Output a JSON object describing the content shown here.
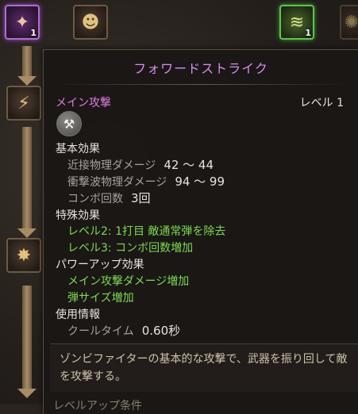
{
  "tree": {
    "top_left_badge": "1",
    "top_right_badge": "1"
  },
  "tooltip": {
    "title": "フォワードストライク",
    "kind": "メイン攻撃",
    "level": "レベル 1",
    "sections": {
      "base": {
        "label": "基本効果",
        "melee_label": "近接物理ダメージ",
        "melee_value": "42 ～ 44",
        "shock_label": "衝撃波物理ダメージ",
        "shock_value": "94 ～ 99",
        "combo_label": "コンボ回数",
        "combo_value": "3回"
      },
      "special": {
        "label": "特殊効果",
        "lines": [
          "レベル2: 1打目 敵通常弾を除去",
          "レベル3: コンボ回数増加"
        ]
      },
      "powerup": {
        "label": "パワーアップ効果",
        "lines": [
          "メイン攻撃ダメージ増加",
          "弾サイズ増加"
        ]
      },
      "usage": {
        "label": "使用情報",
        "cooldown_label": "クールタイム",
        "cooldown_value": "0.60秒"
      }
    },
    "description": "ゾンビファイターの基本的な攻撃で、武器を振り回して敵を攻撃する。",
    "footer_partial": "レベルアップ条件"
  },
  "icons": {
    "weapon": "hammer-icon"
  }
}
